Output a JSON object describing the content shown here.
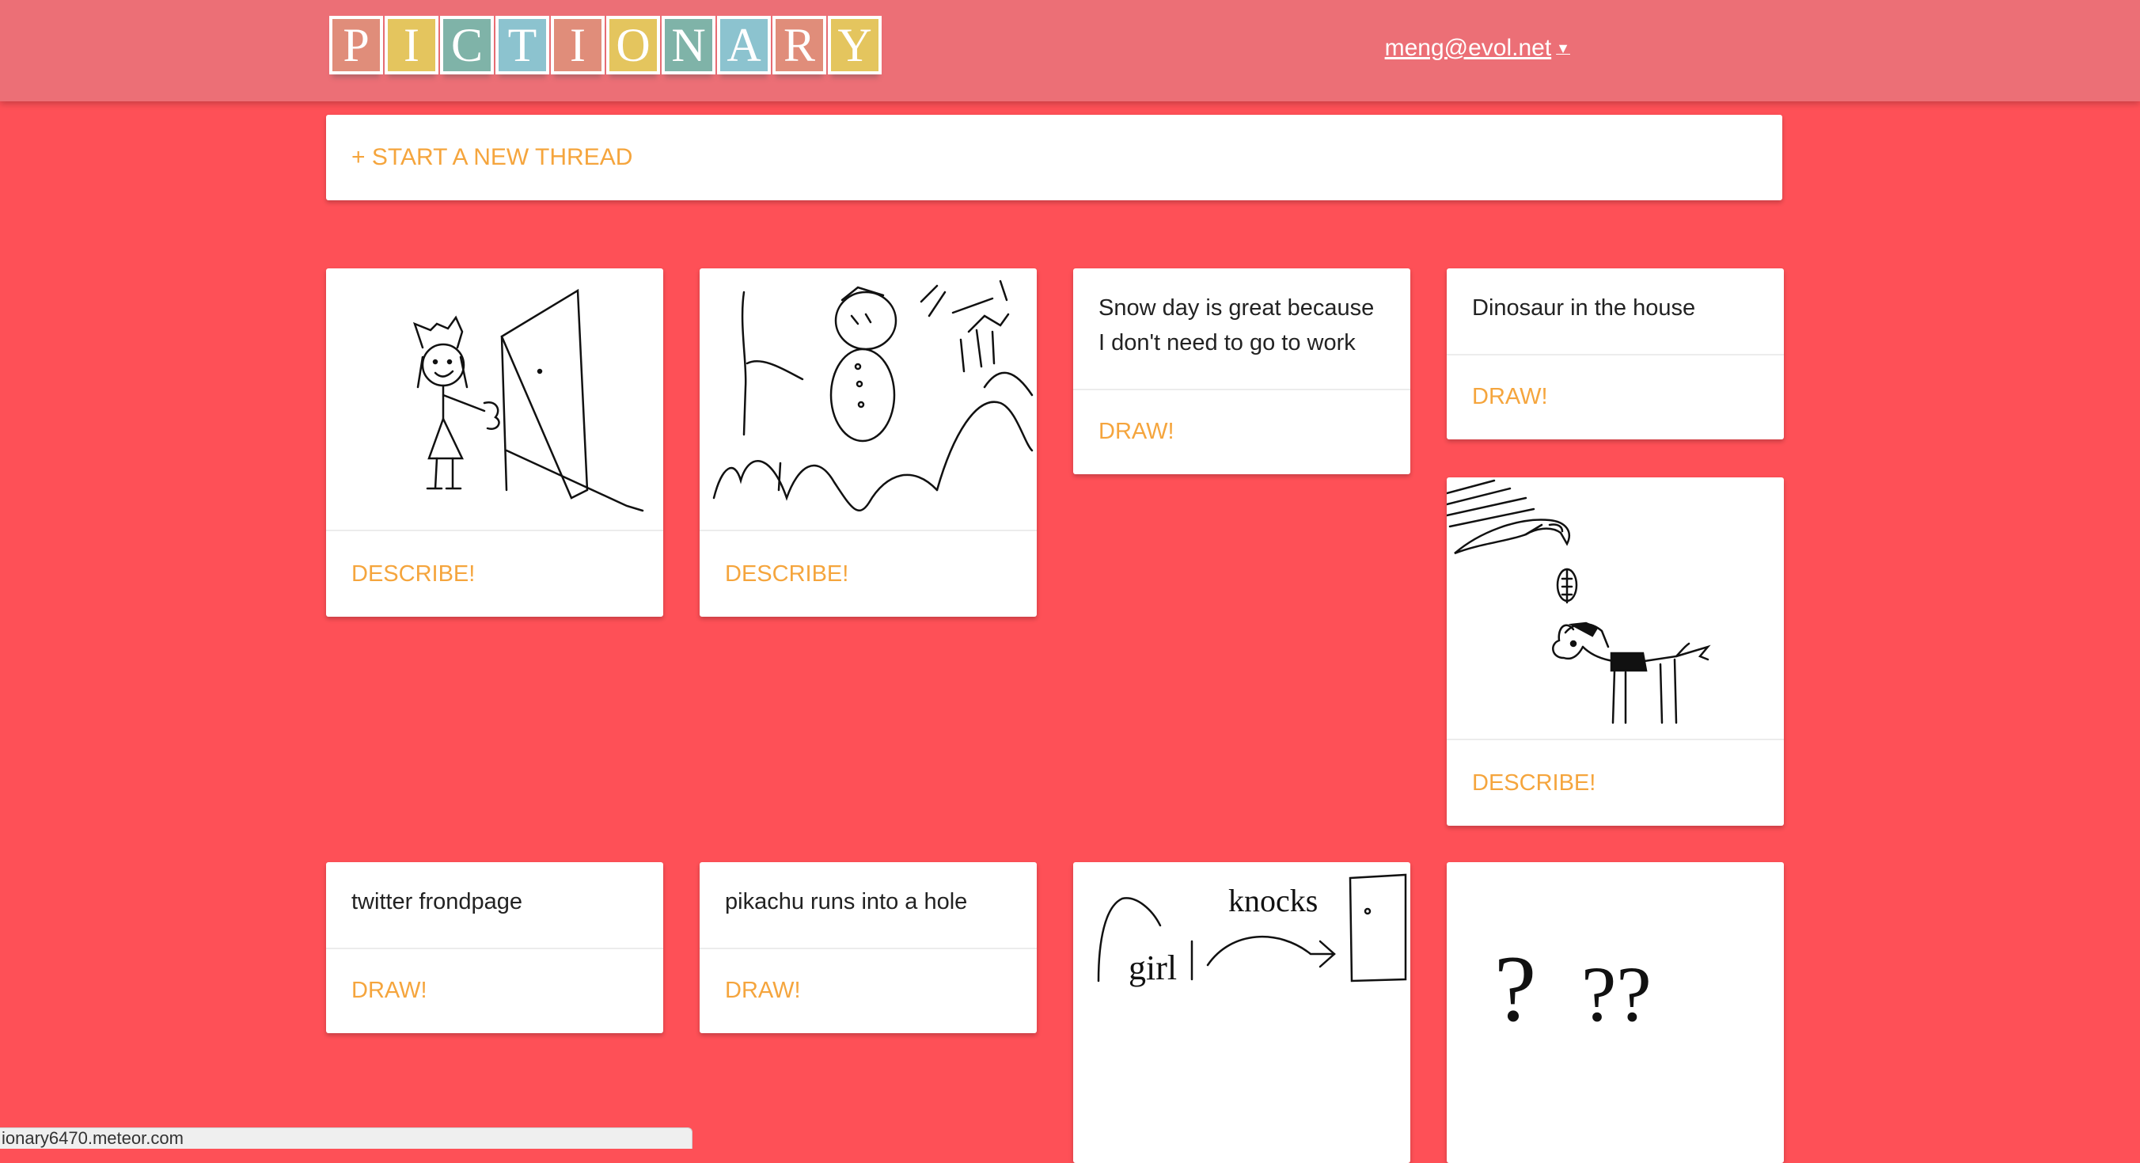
{
  "header": {
    "logo_letters": [
      "P",
      "I",
      "C",
      "T",
      "I",
      "O",
      "N",
      "A",
      "R",
      "Y"
    ],
    "logo_colors": [
      "#e08d7a",
      "#e4c55e",
      "#7fb3a8",
      "#8cc3cf",
      "#e08d7a",
      "#e4c55e",
      "#7fb3a8",
      "#8cc3cf",
      "#e08d7a",
      "#e4c55e"
    ],
    "user_email": "meng@evol.net",
    "caret_icon": "caret-down-icon"
  },
  "new_thread": {
    "label": "+ START A NEW THREAD"
  },
  "cards": [
    {
      "kind": "drawing",
      "image": "girl-knocking-on-door-sketch",
      "action": "DESCRIBE!"
    },
    {
      "kind": "drawing",
      "image": "snowman-mountains-sketch",
      "action": "DESCRIBE!"
    },
    {
      "kind": "text",
      "text_line1": "Snow day is great because",
      "text_line2": "I don't need to go to work",
      "action": "DRAW!"
    },
    {
      "kind": "text",
      "text": "Dinosaur in the house",
      "action": "DRAW!"
    },
    {
      "kind": "drawing",
      "image": "bird-leaf-horse-sketch",
      "action": "DESCRIBE!"
    },
    {
      "kind": "text",
      "text": "twitter frondpage",
      "action": "DRAW!"
    },
    {
      "kind": "text",
      "text": "pikachu runs into a hole",
      "action": "DRAW!"
    },
    {
      "kind": "drawing",
      "image": "girl-knocks-door-diagram-sketch",
      "sketch_words": [
        "girl",
        "knocks"
      ]
    },
    {
      "kind": "drawing",
      "image": "question-marks-sketch",
      "sketch_words": [
        "?",
        "??"
      ]
    }
  ],
  "status_bar": {
    "text": "ionary6470.meteor.com"
  },
  "colors": {
    "background": "#fe5057",
    "navbar": "#ec6f76",
    "accent": "#f5a53d",
    "card": "#ffffff"
  }
}
